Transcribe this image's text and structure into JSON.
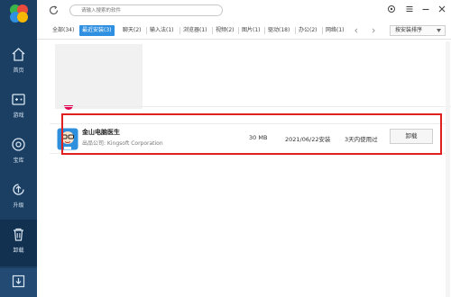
{
  "sidebar": {
    "items": [
      {
        "label": "首页",
        "icon": "home-icon"
      },
      {
        "label": "游戏",
        "icon": "gamepad-icon"
      },
      {
        "label": "宝库",
        "icon": "treasure-icon"
      },
      {
        "label": "升级",
        "icon": "upgrade-icon"
      },
      {
        "label": "卸载",
        "icon": "trash-icon"
      }
    ],
    "active_index": 4,
    "bottom_icon": "download-icon"
  },
  "topbar": {
    "search_placeholder": "请输入搜索的软件"
  },
  "tabs": [
    {
      "label": "全部(34)"
    },
    {
      "label": "最近安装(3)",
      "active": true
    },
    {
      "label": "聊天(2)"
    },
    {
      "label": "输入法(1)"
    },
    {
      "label": "浏览器(1)"
    },
    {
      "label": "视频(2)"
    },
    {
      "label": "图片(1)"
    },
    {
      "label": "驱动(18)"
    },
    {
      "label": "办公(2)"
    },
    {
      "label": "网络(1)"
    }
  ],
  "sort": {
    "label": "按安装排序"
  },
  "app": {
    "name": "金山电脑医生",
    "publisher": "出品公司: Kingsoft Corporation",
    "size": "30 MB",
    "install_date": "2021/06/22安装",
    "last_used": "3天内使用过",
    "uninstall_label": "卸载"
  },
  "colors": {
    "sidebar": "#1b3f63",
    "active_tab": "#2f8fe0",
    "highlight": "#e0201f"
  }
}
